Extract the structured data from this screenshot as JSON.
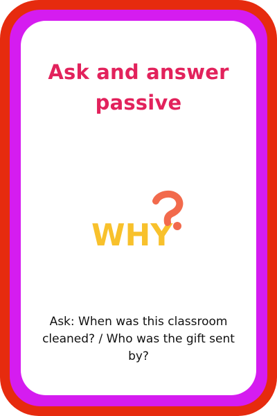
{
  "card": {
    "title_lines": [
      "Ask and answer",
      "passive"
    ],
    "icon": {
      "name": "why-question-icon",
      "text": "WHY",
      "text_color": "#f8c12c",
      "mark_color": "#f26a4c"
    },
    "question_lines": [
      "Ask: When was this classroom",
      "cleaned? / Who was the gift sent",
      "by?"
    ]
  },
  "colors": {
    "outer_frame": "#e62b0e",
    "middle_frame": "#d51cf0",
    "inner_panel": "#ffffff",
    "title": "#e2225c"
  }
}
